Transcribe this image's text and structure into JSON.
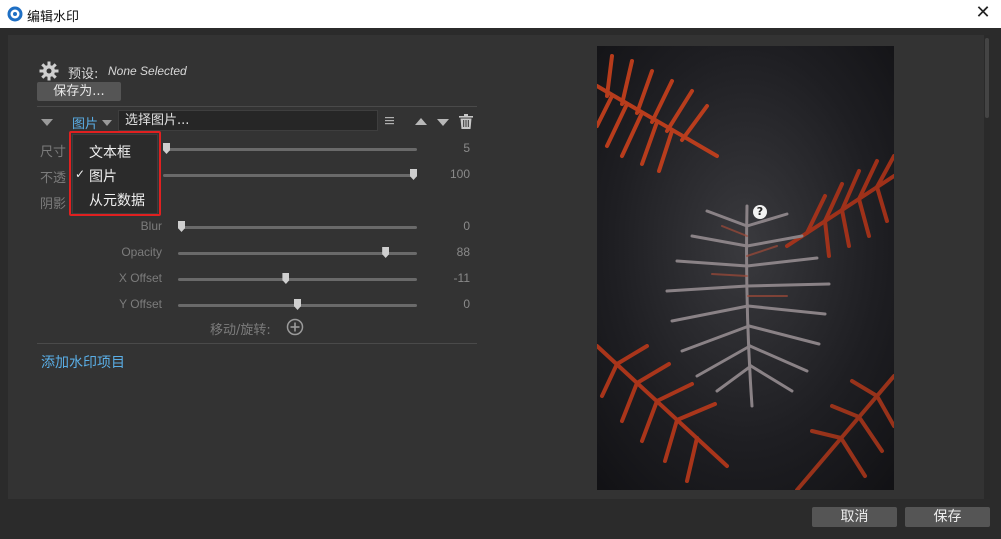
{
  "window": {
    "title": "编辑水印"
  },
  "preset": {
    "label": "预设:",
    "value": "None Selected",
    "save_as": "保存为..."
  },
  "item": {
    "type": "图片",
    "choose": "选择图片..."
  },
  "rows": {
    "size_label": "尺寸",
    "opacity_label": "不透",
    "shadow_label": "阴影"
  },
  "sliders": [
    {
      "label": "",
      "value": "5",
      "fraction": 0.0
    },
    {
      "label": "",
      "value": "100",
      "fraction": 1.0
    },
    {
      "label": "Blur",
      "value": "0",
      "fraction": 0.0
    },
    {
      "label": "Opacity",
      "value": "88",
      "fraction": 0.88
    },
    {
      "label": "X Offset",
      "value": "-11",
      "fraction": 0.45
    },
    {
      "label": "Y Offset",
      "value": "0",
      "fraction": 0.5
    }
  ],
  "move_rotate": "移动/旋转:",
  "add_item": "添加水印项目",
  "dropdown": {
    "options": [
      "文本框",
      "图片",
      "从元数据"
    ],
    "selected": "图片",
    "check": "✓"
  },
  "help": "?",
  "footer": {
    "cancel": "取消",
    "save": "保存"
  },
  "colors": {
    "accent": "#5aaee6",
    "highlight": "#e02020"
  }
}
